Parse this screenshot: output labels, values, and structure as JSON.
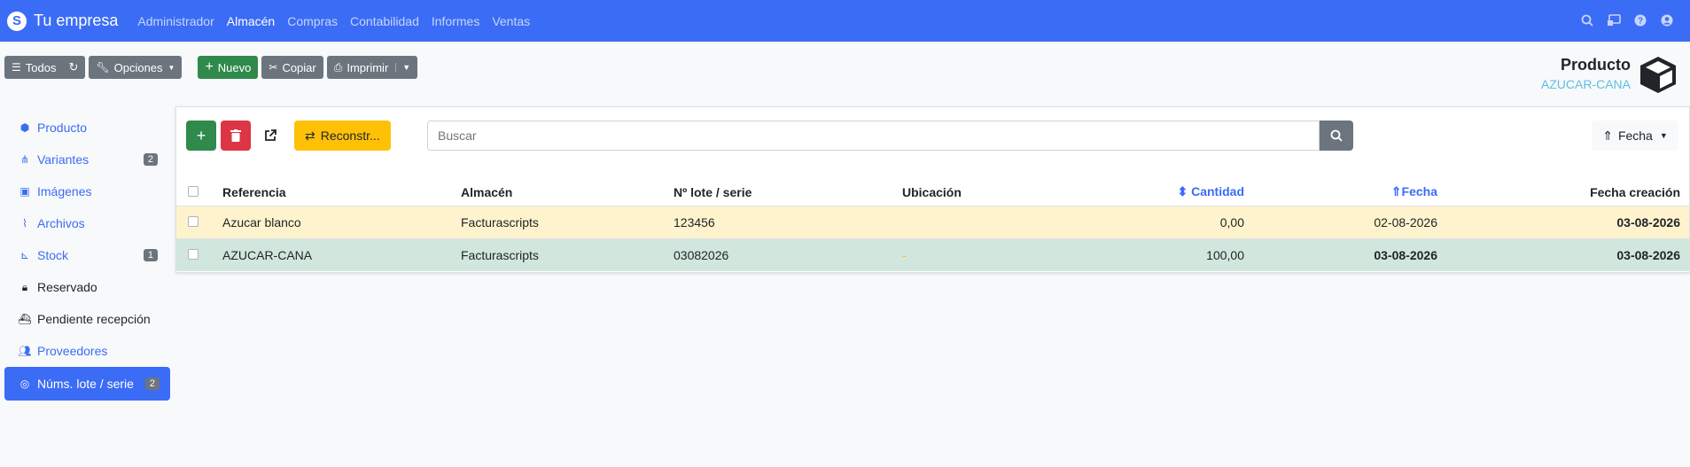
{
  "brand": {
    "name": "Tu empresa"
  },
  "menu": [
    "Administrador",
    "Almacén",
    "Compras",
    "Contabilidad",
    "Informes",
    "Ventas"
  ],
  "menu_active": "Almacén",
  "toolbar": {
    "todos": "Todos",
    "opciones": "Opciones",
    "nuevo": "Nuevo",
    "copiar": "Copiar",
    "imprimir": "Imprimir"
  },
  "product": {
    "title": "Producto",
    "code": "AZUCAR-CANA"
  },
  "sidebar": {
    "items": [
      {
        "label": "Producto",
        "badge": ""
      },
      {
        "label": "Variantes",
        "badge": "2"
      },
      {
        "label": "Imágenes",
        "badge": ""
      },
      {
        "label": "Archivos",
        "badge": ""
      },
      {
        "label": "Stock",
        "badge": "1"
      },
      {
        "label": "Reservado",
        "badge": ""
      },
      {
        "label": "Pendiente recepción",
        "badge": ""
      },
      {
        "label": "Proveedores",
        "badge": ""
      },
      {
        "label": "Núms. lote / serie",
        "badge": "2"
      }
    ]
  },
  "panel": {
    "rebuild_label": "Reconstr...",
    "search_placeholder": "Buscar",
    "sort_label": "Fecha",
    "columns": [
      "Referencia",
      "Almacén",
      "Nº lote / serie",
      "Ubicación",
      "Cantidad",
      "Fecha",
      "Fecha creación"
    ],
    "rows": [
      {
        "referencia": "Azucar blanco",
        "almacen": "Facturascripts",
        "lote": "123456",
        "ubicacion": "",
        "cantidad": "0,00",
        "fecha": "02-08-2026",
        "fecha_creacion": "03-08-2026"
      },
      {
        "referencia": "AZUCAR-CANA",
        "almacen": "Facturascripts",
        "lote": "03082026",
        "ubicacion": "-",
        "cantidad": "100,00",
        "fecha": "03-08-2026",
        "fecha_creacion": "03-08-2026"
      }
    ]
  }
}
